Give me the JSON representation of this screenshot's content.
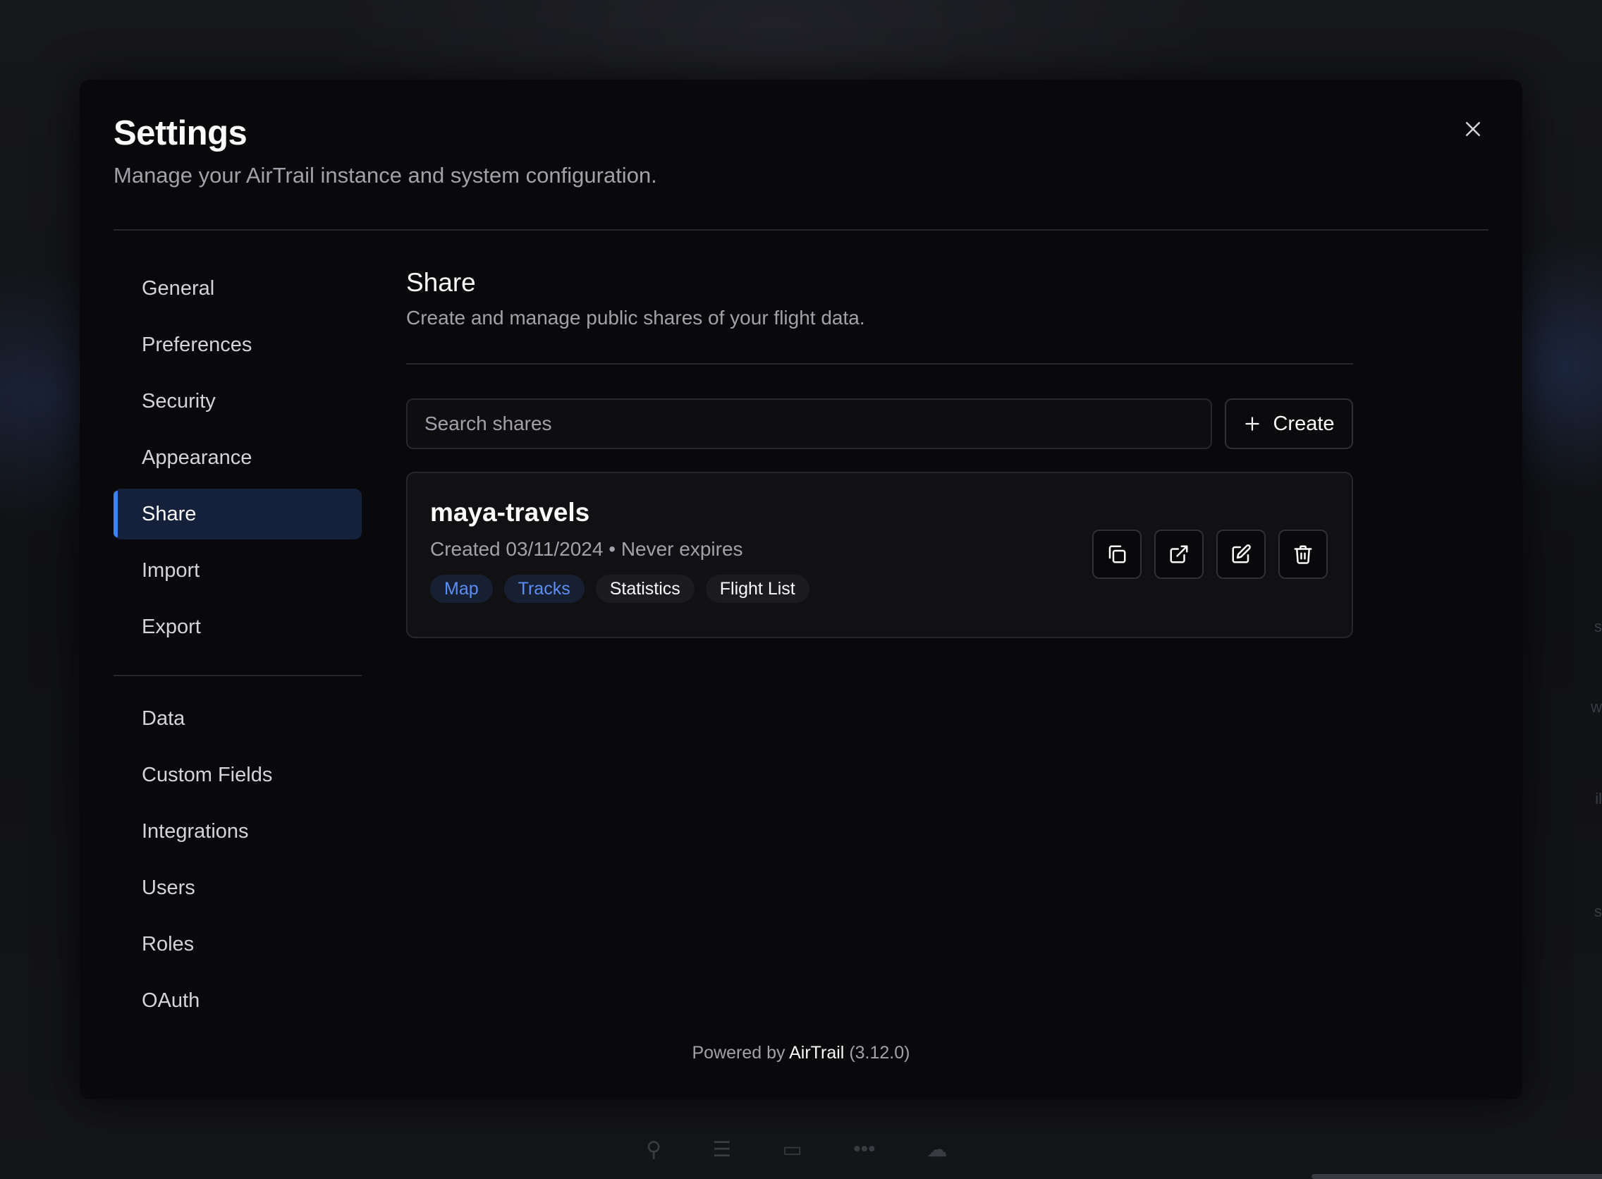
{
  "modal": {
    "title": "Settings",
    "subtitle": "Manage your AirTrail instance and system configuration."
  },
  "sidebar": {
    "items": [
      {
        "id": "general",
        "label": "General"
      },
      {
        "id": "preferences",
        "label": "Preferences"
      },
      {
        "id": "security",
        "label": "Security"
      },
      {
        "id": "appearance",
        "label": "Appearance"
      },
      {
        "id": "share",
        "label": "Share",
        "active": true
      },
      {
        "id": "import",
        "label": "Import"
      },
      {
        "id": "export",
        "label": "Export"
      }
    ],
    "admin_items": [
      {
        "id": "data",
        "label": "Data"
      },
      {
        "id": "custom-fields",
        "label": "Custom Fields"
      },
      {
        "id": "integrations",
        "label": "Integrations"
      },
      {
        "id": "users",
        "label": "Users"
      },
      {
        "id": "roles",
        "label": "Roles"
      },
      {
        "id": "oauth",
        "label": "OAuth"
      }
    ]
  },
  "share_section": {
    "title": "Share",
    "description": "Create and manage public shares of your flight data.",
    "search_placeholder": "Search shares",
    "search_value": "",
    "create_label": "Create",
    "shares": [
      {
        "name": "maya-travels",
        "meta": "Created 03/11/2024 • Never expires",
        "tags": [
          {
            "label": "Map",
            "style": "enabled"
          },
          {
            "label": "Tracks",
            "style": "enabled"
          },
          {
            "label": "Statistics",
            "style": "neutral"
          },
          {
            "label": "Flight List",
            "style": "neutral"
          }
        ],
        "actions": [
          "copy-icon",
          "external-link-icon",
          "edit-icon",
          "trash-icon"
        ]
      }
    ]
  },
  "footer": {
    "prefix": "Powered by",
    "brand": "AirTrail",
    "version": "(3.12.0)"
  },
  "colors": {
    "accent": "#3b82f6",
    "active_nav_bg": "#15203a",
    "tag_enabled_text": "#5b8ff5"
  }
}
